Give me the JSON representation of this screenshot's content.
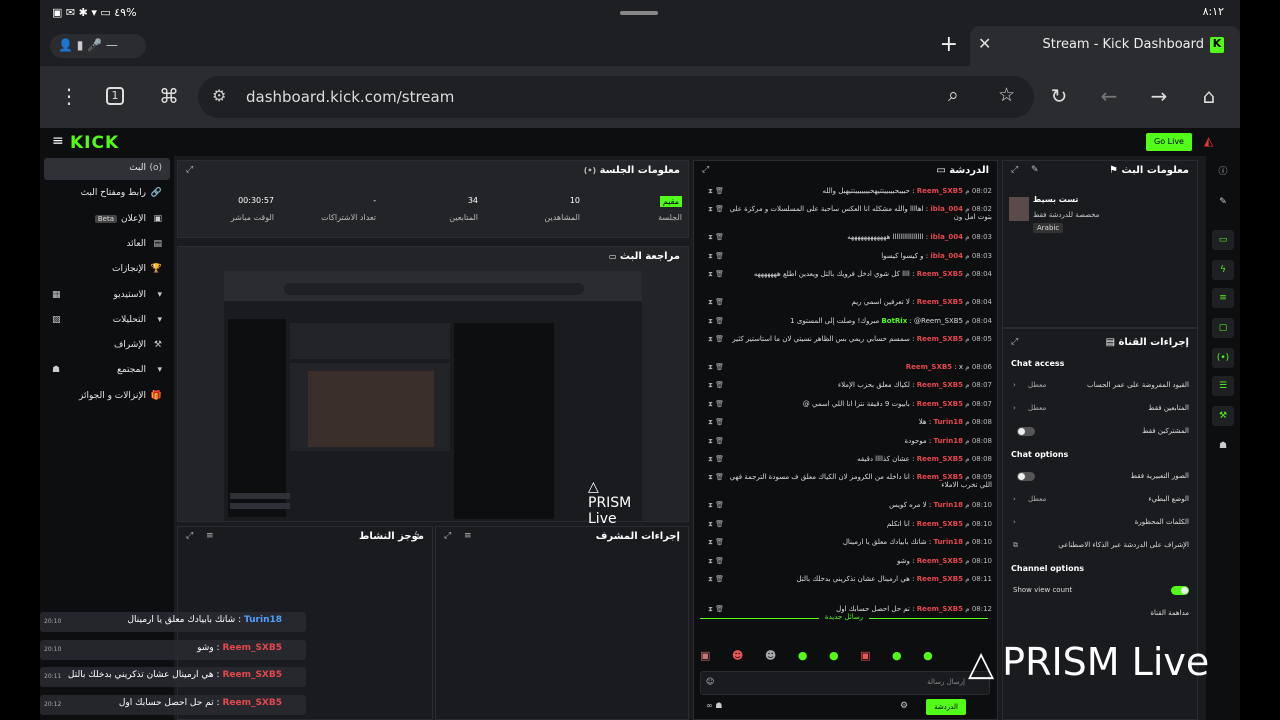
{
  "status_bar": {
    "time": "٨:١٢",
    "battery": "%٤٩"
  },
  "browser": {
    "tab_title": "Stream - Kick Dashboard",
    "url": "dashboard.kick.com/stream",
    "tab_count": "1"
  },
  "app": {
    "logo": "KICK",
    "go_live": "Go Live",
    "nav": [
      {
        "label": "البث",
        "icon": "(o)",
        "active": true
      },
      {
        "label": "رابط ومفتاح البث",
        "icon": "🔗"
      },
      {
        "label": "الإعلان",
        "icon": "▣",
        "badge": "Beta"
      },
      {
        "label": "العائد",
        "icon": "▤"
      },
      {
        "label": "الإنجازات",
        "icon": "🏆"
      },
      {
        "label": "الاستيديو",
        "icon": "▾",
        "right": "▦"
      },
      {
        "label": "التحليلات",
        "icon": "▾",
        "right": "▨"
      },
      {
        "label": "الإشراف",
        "icon": "⚒"
      },
      {
        "label": "المجتمع",
        "icon": "▾",
        "right": "☗"
      },
      {
        "label": "الإنزالات و الجوائز",
        "icon": "🎁"
      }
    ]
  },
  "session": {
    "title": "معلومات الجلسة",
    "stats": [
      {
        "value": "مقيم",
        "label": "الجلسة"
      },
      {
        "value": "10",
        "label": "المشاهدين"
      },
      {
        "value": "34",
        "label": "المتابعين"
      },
      {
        "value": "-",
        "label": "تعداد الاشتراكات"
      },
      {
        "value": "00:30:57",
        "label": "الوقت مباشر"
      }
    ]
  },
  "preview": {
    "title": "مراجعة البث",
    "watermark": "PRISM Live"
  },
  "activity": {
    "title": "موجز النشاط"
  },
  "mod_actions": {
    "title": "إجراءات المشرف"
  },
  "chat": {
    "title": "الدردشة",
    "new_messages": "رسائل جديدة",
    "input_placeholder": "إرسال رسالة",
    "send": "الدردشة",
    "messages": [
      {
        "time": "08:02 م",
        "user": "Reem_SXB5",
        "color": "red",
        "text": "حبيبحبيبييتتيهحبيبيبييتتيهبل والله"
      },
      {
        "time": "08:02 م",
        "user": "ibla_004",
        "color": "red",
        "text": "اهاااا والله مشكله انا العكس ساحبة على المسلسلات و مركزة على بتوت امل ون"
      },
      {
        "time": "08:03 م",
        "user": "ibla_004",
        "color": "red",
        "text": "اااااااااااااااا ههههههههههههه"
      },
      {
        "time": "08:03 م",
        "user": "ibla_004",
        "color": "red",
        "text": "و كيسوا كيسوا"
      },
      {
        "time": "08:04 م",
        "user": "Reem_SXB5",
        "color": "red",
        "text": "اااا كل شوي ادخل فرويك بالتل ويعدين اطلع هههههههه"
      },
      {
        "time": "08:04 م",
        "user": "Reem_SXB5",
        "color": "red",
        "text": "لا تعرفين اسمي ريم"
      },
      {
        "time": "08:04 م",
        "user": "BotRix",
        "color": "green",
        "text": "@Reem_SXB5 مبروك! وصلت إلى المستوى 1"
      },
      {
        "time": "08:05 م",
        "user": "Reem_SXB5",
        "color": "red",
        "text": "سمسم حسابي ريمي بس الظاهر نسيتي لان ما استاستير كثير"
      },
      {
        "time": "08:06 م",
        "user": "Reem_SXB5",
        "color": "red",
        "text": "x"
      },
      {
        "time": "08:07 م",
        "user": "Reem_SXB5",
        "color": "red",
        "text": "لكياك معلق بحزب الإملاء"
      },
      {
        "time": "08:07 م",
        "user": "Reem_SXB5",
        "color": "red",
        "text": "بابيوت 9 دقيقة نترا انا اللي اسمي @"
      },
      {
        "time": "08:08 م",
        "user": "Turin18",
        "color": "red",
        "text": "هلا"
      },
      {
        "time": "08:08 م",
        "user": "Turin18",
        "color": "red",
        "text": "موجودة"
      },
      {
        "time": "08:08 م",
        "user": "Reem_SXB5",
        "color": "red",
        "text": "عشان كذاااا دقيقه"
      },
      {
        "time": "08:09 م",
        "user": "Reem_SXB5",
        "color": "red",
        "text": "انا داخله من الكرومز لان الكياك معلق ف مسودة الترجمة فهي اللي تخرب الاملاء"
      },
      {
        "time": "08:10 م",
        "user": "Turin18",
        "color": "red",
        "text": "لا مره كويس"
      },
      {
        "time": "08:10 م",
        "user": "Reem_SXB5",
        "color": "red",
        "text": "انا اتكلم"
      },
      {
        "time": "08:10 م",
        "user": "Turin18",
        "color": "red",
        "text": "شاتك بابيادك معلق يا ارمينال"
      },
      {
        "time": "08:10 م",
        "user": "Reem_SXB5",
        "color": "red",
        "text": "وشو"
      },
      {
        "time": "08:11 م",
        "user": "Reem_SXB5",
        "color": "red",
        "text": "هي ارمينال عشان تذكريني بدخلك بالتل"
      },
      {
        "time": "08:12 م",
        "user": "Reem_SXB5",
        "color": "red",
        "text": "تم حل احصل حسابك اول"
      }
    ]
  },
  "stream_info": {
    "title": "معلومات البث",
    "stream_title": "تست بسيط",
    "category": "مخصصة للدردشة فقط",
    "language": "Arabic"
  },
  "channel_actions": {
    "title": "إجراءات القناة",
    "chat_access": "Chat access",
    "chat_access_rows": [
      {
        "label": "القيود المفروضة على عمر الحساب",
        "value": "معطل",
        "type": "chev"
      },
      {
        "label": "المتابعين فقط",
        "value": "معطل",
        "type": "chev"
      },
      {
        "label": "المشتركين فقط",
        "type": "toggle",
        "on": false
      }
    ],
    "chat_options": "Chat options",
    "chat_options_rows": [
      {
        "label": "الصور التعبيرية فقط",
        "type": "toggle",
        "on": false
      },
      {
        "label": "الوضع البطيء",
        "value": "معطل",
        "type": "chev"
      },
      {
        "label": "الكلمات المحظورة",
        "type": "chev"
      },
      {
        "label": "الإشراف على الدردشة عبر الذكاء الاصطناعي",
        "type": "ext"
      }
    ],
    "channel_options": "Channel options",
    "channel_options_rows": [
      {
        "label": "Show view count",
        "type": "toggle",
        "on": true
      },
      {
        "label": "مداهمة القناة",
        "type": "none"
      }
    ]
  },
  "overlay": {
    "messages": [
      {
        "time": "20:10",
        "user": "Turin18",
        "color": "blue",
        "text": "شاتك بابيادك معلق يا ارمينال"
      },
      {
        "time": "20:10",
        "user": "Reem_SXB5",
        "color": "red",
        "text": "وشو"
      },
      {
        "time": "20:11",
        "user": "Reem_SXB5",
        "color": "red",
        "text": "هي ارمينال عشان تذكريني بدخلك بالتل"
      },
      {
        "time": "20:12",
        "user": "Reem_SXB5",
        "color": "red",
        "text": "تم حل احصل حسابك اول"
      }
    ]
  },
  "watermark": "PRISM Live",
  "colors": {
    "accent": "#53fc18",
    "username_red": "#e5484d",
    "bg": "#191b1f"
  }
}
